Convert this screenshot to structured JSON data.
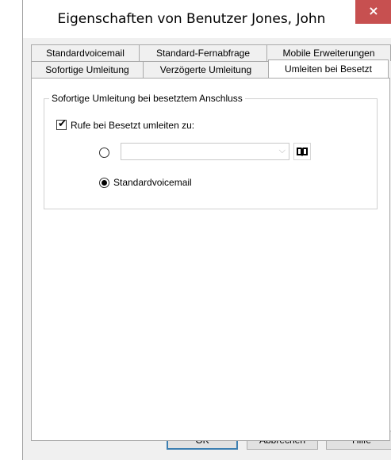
{
  "window": {
    "title": "Eigenschaften von Benutzer Jones, John",
    "close_label": "×"
  },
  "tabs_back": [
    {
      "label": "Standardvoicemail"
    },
    {
      "label": "Standard-Fernabfrage"
    },
    {
      "label": "Mobile Erweiterungen"
    }
  ],
  "tabs_front": [
    {
      "label": "Sofortige Umleitung"
    },
    {
      "label": "Verzögerte Umleitung"
    },
    {
      "label": "Umleiten bei Besetzt",
      "active": true
    }
  ],
  "group": {
    "legend": "Sofortige Umleitung bei besetztem Anschluss",
    "checkbox_label": "Rufe bei Besetzt umleiten zu:",
    "checkbox_checked": true,
    "number_combo_value": "",
    "radio_number_selected": false,
    "radio_voicemail_label": "Standardvoicemail",
    "radio_voicemail_selected": true
  },
  "icons": {
    "book": "address-book-icon",
    "dropdown": "chevron-down-icon"
  },
  "buttons": {
    "ok": "OK",
    "cancel": "Abbrechen",
    "help": "Hilfe"
  },
  "colors": {
    "close_button": "#c75050",
    "default_button_border": "#3c7fb1"
  }
}
